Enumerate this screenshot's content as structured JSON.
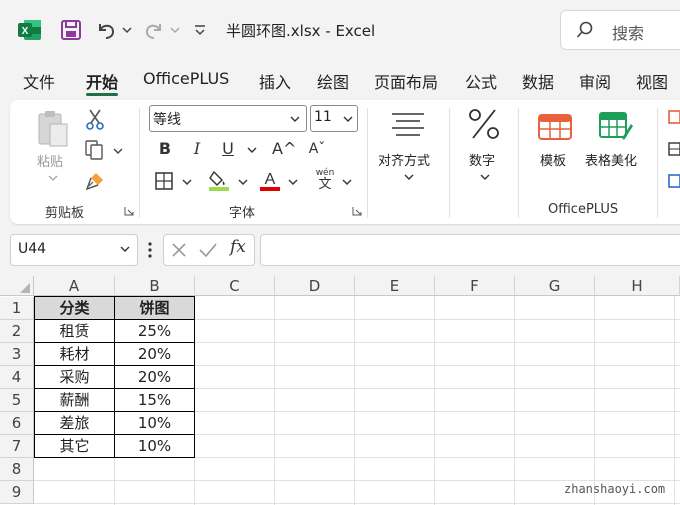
{
  "app": {
    "name": "Excel",
    "document_title": "半圆环图.xlsx  -  Excel"
  },
  "colors": {
    "excel_green": "#1e7145",
    "header_fill": "#d9d9d9",
    "font_color_red": "#e00000",
    "fill_color_yellow": "#9bdc4a"
  },
  "quick_access": {
    "save_icon": "save-icon",
    "undo_icon": "undo-icon",
    "redo_icon": "redo-icon",
    "customize_icon": "customize-toolbar-icon"
  },
  "search": {
    "placeholder": "搜索"
  },
  "menu": {
    "tabs": [
      {
        "label": "文件",
        "active": false
      },
      {
        "label": "开始",
        "active": true
      },
      {
        "label": "OfficePLUS",
        "active": false
      },
      {
        "label": "插入",
        "active": false
      },
      {
        "label": "绘图",
        "active": false
      },
      {
        "label": "页面布局",
        "active": false
      },
      {
        "label": "公式",
        "active": false
      },
      {
        "label": "数据",
        "active": false
      },
      {
        "label": "审阅",
        "active": false
      },
      {
        "label": "视图",
        "active": false
      }
    ]
  },
  "ribbon": {
    "clipboard": {
      "group_label": "剪贴板",
      "paste_label": "粘贴"
    },
    "font": {
      "group_label": "字体",
      "font_name": "等线",
      "font_size": "11",
      "bold": "B",
      "italic": "I",
      "underline": "U",
      "increase": "A^",
      "decrease": "Aˇ",
      "phonetic_top": "wén",
      "phonetic_bottom": "文"
    },
    "alignment": {
      "label": "对齐方式"
    },
    "number": {
      "label": "数字"
    },
    "officeplus": {
      "group_label": "OfficePLUS",
      "template_label": "模板",
      "beautify_label": "表格美化"
    }
  },
  "formula_bar": {
    "name_box": "U44",
    "fx_label": "fx",
    "formula": ""
  },
  "sheet": {
    "columns": [
      "A",
      "B",
      "C",
      "D",
      "E",
      "F",
      "G",
      "H"
    ],
    "rows": [
      "1",
      "2",
      "3",
      "4",
      "5",
      "6",
      "7",
      "8",
      "9"
    ],
    "table": {
      "headers": [
        "分类",
        "饼图"
      ],
      "rows": [
        [
          "租赁",
          "25%"
        ],
        [
          "耗材",
          "20%"
        ],
        [
          "采购",
          "20%"
        ],
        [
          "薪酬",
          "15%"
        ],
        [
          "差旅",
          "10%"
        ],
        [
          "其它",
          "10%"
        ]
      ]
    }
  },
  "watermark": "zhanshaoyi.com"
}
